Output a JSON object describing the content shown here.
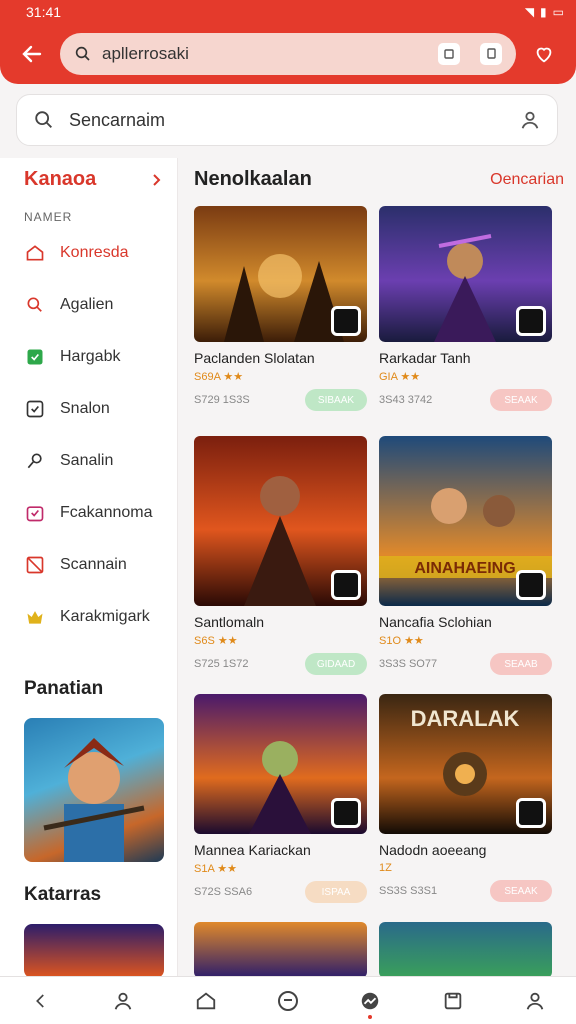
{
  "status": {
    "time": "31:41"
  },
  "url_bar": {
    "text": "apllerrosaki"
  },
  "search": {
    "placeholder": "Sencarnaim"
  },
  "sidebar": {
    "title": "Kanaoa",
    "section": "NAMER",
    "items": [
      {
        "label": "Konresda",
        "icon": "house-icon",
        "color": "#d9372b"
      },
      {
        "label": "Agalien",
        "icon": "search-icon",
        "color": "#d9372b"
      },
      {
        "label": "Hargabk",
        "icon": "bookmark-icon",
        "color": "#2ea84a"
      },
      {
        "label": "Snalon",
        "icon": "check-box-icon",
        "color": "#333333"
      },
      {
        "label": "Sanalin",
        "icon": "pin-icon",
        "color": "#333333"
      },
      {
        "label": "Fcakannoma",
        "icon": "bag-icon",
        "color": "#c02a6a"
      },
      {
        "label": "Scannain",
        "icon": "flag-icon",
        "color": "#d9372b"
      },
      {
        "label": "Karakmigark",
        "icon": "crown-icon",
        "color": "#e0b21b"
      }
    ],
    "heading_1": "Panatian",
    "heading_2": "Katarras"
  },
  "main": {
    "title": "Nenolkaalan",
    "link": "Oencarian",
    "cards": [
      {
        "title": "Paclanden Slolatan",
        "rating": "S69A ★★",
        "size": "S729 1S3S",
        "button": "SIBAAK",
        "button_color": "#bfe7c6",
        "colors": [
          "#7a3b12",
          "#d18a2c",
          "#3c1d08"
        ]
      },
      {
        "title": "Rarkadar Tanh",
        "rating": "GIA ★★",
        "size": "3S43 3742",
        "button": "SEAAK",
        "button_color": "#f6c6c3",
        "colors": [
          "#2b2f6b",
          "#6b3fb0",
          "#191b3d"
        ]
      },
      {
        "title": "Santlomaln",
        "rating": "S6S ★★",
        "size": "S725 1S72",
        "button": "GIDAAD",
        "button_color": "#bfe7c6",
        "colors": [
          "#7b1f0e",
          "#e0561e",
          "#2a0a05"
        ]
      },
      {
        "title": "Nancafia Sclohian",
        "rating": "S1O ★★",
        "size": "3S3S SO77",
        "button": "SEAAB",
        "button_color": "#f6c6c3",
        "colors": [
          "#1f4a7a",
          "#e0892b",
          "#0c2a4a"
        ]
      },
      {
        "title": "Mannea Kariackan",
        "rating": "S1A ★★",
        "size": "S72S SSA6",
        "button": "ISPAA",
        "button_color": "#f6dcc3",
        "colors": [
          "#4a1a6b",
          "#e06b1e",
          "#1a0a2e"
        ]
      },
      {
        "title": "Nadodn aoeeang",
        "rating": "1Z",
        "size": "SS3S S3S1",
        "button": "SEAAK",
        "button_color": "#f6c6c3",
        "colors": [
          "#3a2612",
          "#c4661e",
          "#120b05"
        ]
      }
    ]
  },
  "thumb_banner_1": "AINAHAEING",
  "thumb_banner_2": "DARALAK"
}
